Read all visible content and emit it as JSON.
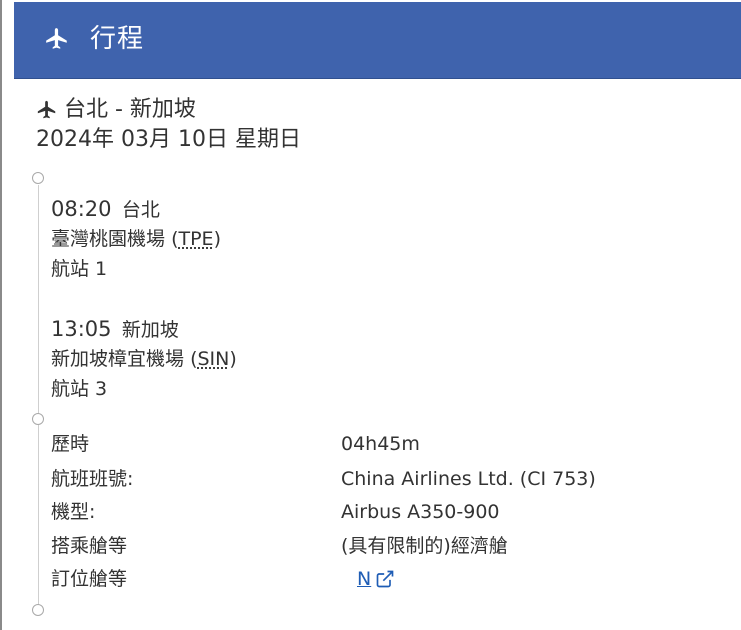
{
  "header": {
    "title": "行程",
    "icon": "plane-icon",
    "bg_color": "#3f63ad"
  },
  "trip": {
    "route": "台北 - 新加坡",
    "date": "2024年 03月 10日 星期日"
  },
  "departure": {
    "time": "08:20",
    "city": "台北",
    "airport_name": "臺灣桃園機場",
    "airport_code": "TPE",
    "terminal": "航站 1"
  },
  "arrival": {
    "time": "13:05",
    "city": "新加坡",
    "airport_name": "新加坡樟宜機場",
    "airport_code": "SIN",
    "terminal": "航站 3"
  },
  "details": {
    "duration_label": "歷時",
    "duration_value": "04h45m",
    "flight_label": "航班班號:",
    "flight_value": "China Airlines Ltd. (CI 753)",
    "aircraft_label": "機型:",
    "aircraft_value": "Airbus A350-900",
    "cabin_label": "搭乘艙等",
    "cabin_value": "(具有限制的)經濟艙",
    "booking_label": "訂位艙等",
    "booking_value": "N",
    "booking_link_icon": "external-link-icon",
    "link_color": "#1f5db5"
  }
}
